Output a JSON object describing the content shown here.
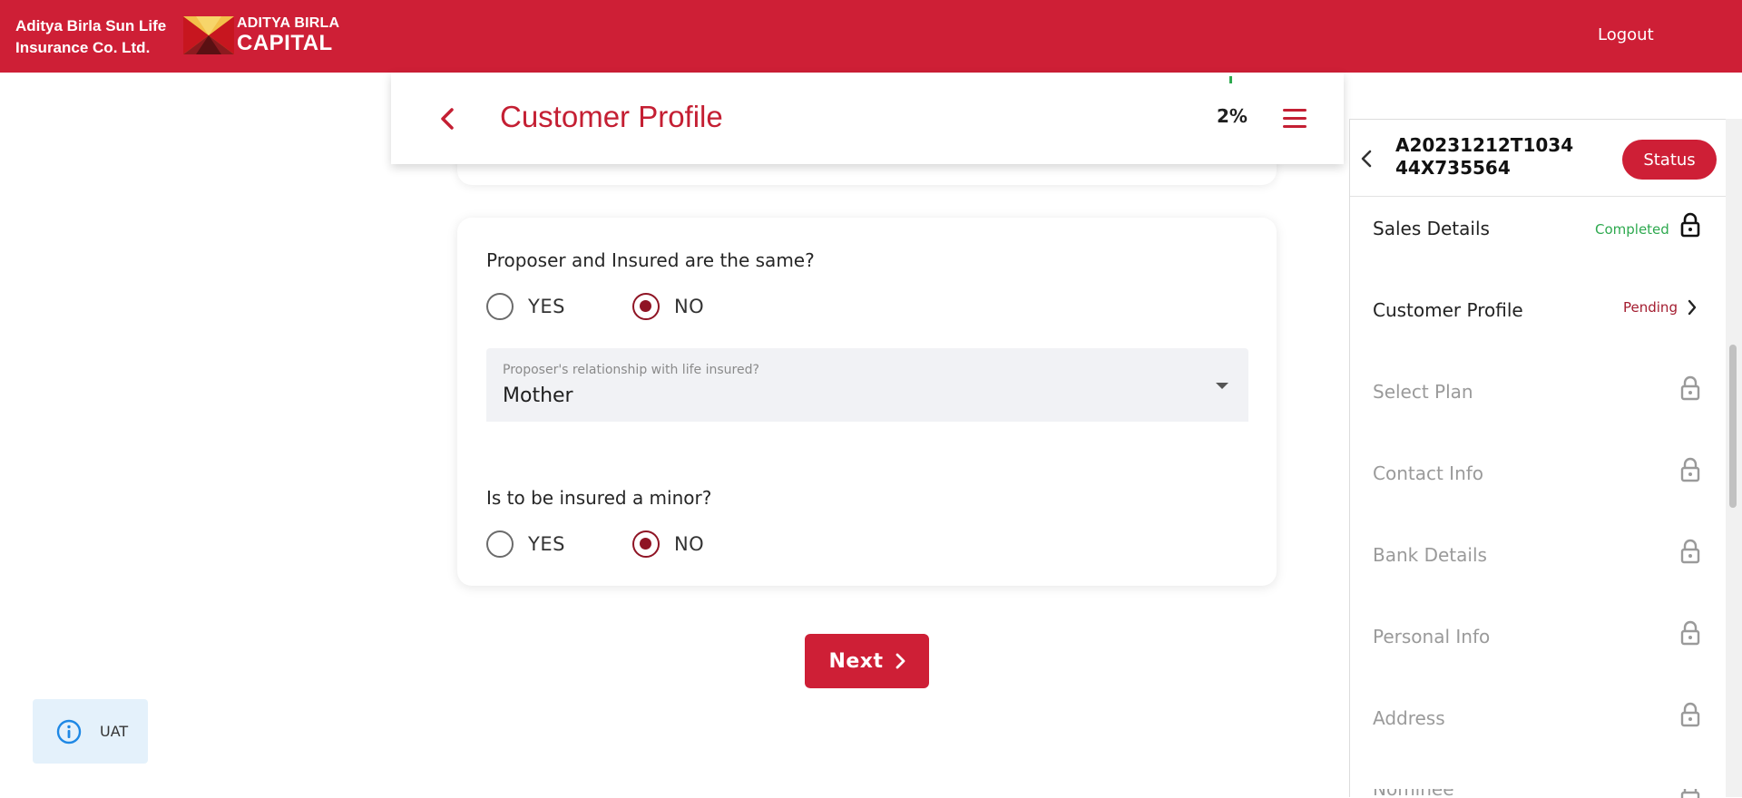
{
  "brand": {
    "company_line1": "Aditya Birla Sun Life",
    "company_line2": "Insurance Co. Ltd.",
    "logo_line1": "ADITYA BIRLA",
    "logo_line2": "CAPITAL"
  },
  "topbar": {
    "logout_label": "Logout"
  },
  "header": {
    "title": "Customer Profile",
    "progress_text": "2%"
  },
  "form": {
    "q1": {
      "label": "Proposer and Insured are the same?",
      "options": [
        "YES",
        "NO"
      ],
      "selected": "NO"
    },
    "relationship": {
      "label": "Proposer's relationship with life insured?",
      "value": "Mother"
    },
    "q2": {
      "label": "Is to be insured a minor?",
      "options": [
        "YES",
        "NO"
      ],
      "selected": "NO"
    }
  },
  "next_label": "Next",
  "uat_label": "UAT",
  "sidebar": {
    "application_id": "A20231212T103444X735564",
    "status_label": "Status",
    "items": [
      {
        "label": "Sales Details",
        "state": "Completed",
        "icon": "lock-icon"
      },
      {
        "label": "Customer Profile",
        "state": "Pending",
        "icon": "chevron-right-icon"
      },
      {
        "label": "Select Plan",
        "state": "",
        "icon": "lock-icon"
      },
      {
        "label": "Contact Info",
        "state": "",
        "icon": "lock-icon"
      },
      {
        "label": "Bank Details",
        "state": "",
        "icon": "lock-icon"
      },
      {
        "label": "Personal Info",
        "state": "",
        "icon": "lock-icon"
      },
      {
        "label": "Address",
        "state": "",
        "icon": "lock-icon"
      },
      {
        "label": "Nominee",
        "state": "",
        "icon": "lock-icon"
      }
    ]
  },
  "colors": {
    "brand_red": "#ce1f36",
    "radio_selected": "#8f1424",
    "completed_green": "#2ea94f",
    "pending_red": "#a31c2f"
  }
}
